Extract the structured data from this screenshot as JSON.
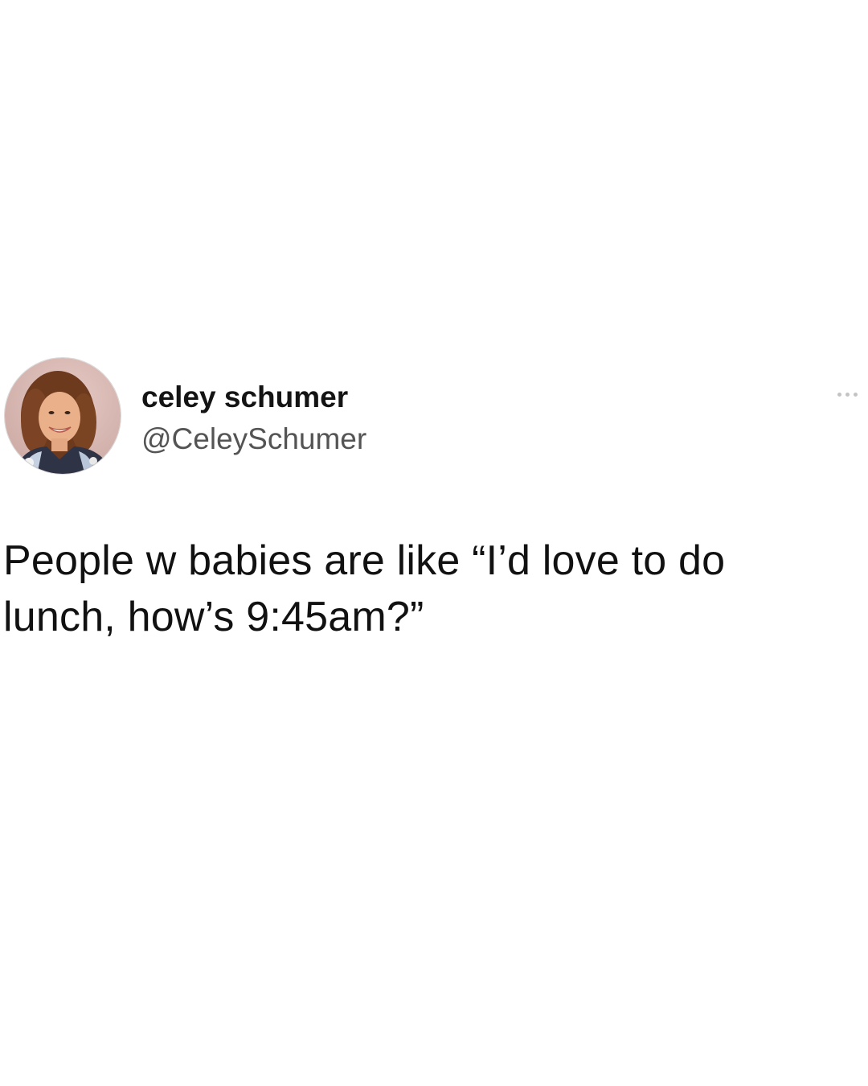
{
  "tweet": {
    "author": {
      "display_name": "celey schumer",
      "handle": "@CeleySchumer"
    },
    "text_line_1": "People w babies are like “I’d love to do",
    "text_line_2": "lunch, how’s 9:45am?”",
    "more_icon": "ellipsis-icon"
  },
  "colors": {
    "background": "#ffffff",
    "name": "#141414",
    "handle": "#545454",
    "text": "#111111",
    "more": "#c4c4c4"
  }
}
